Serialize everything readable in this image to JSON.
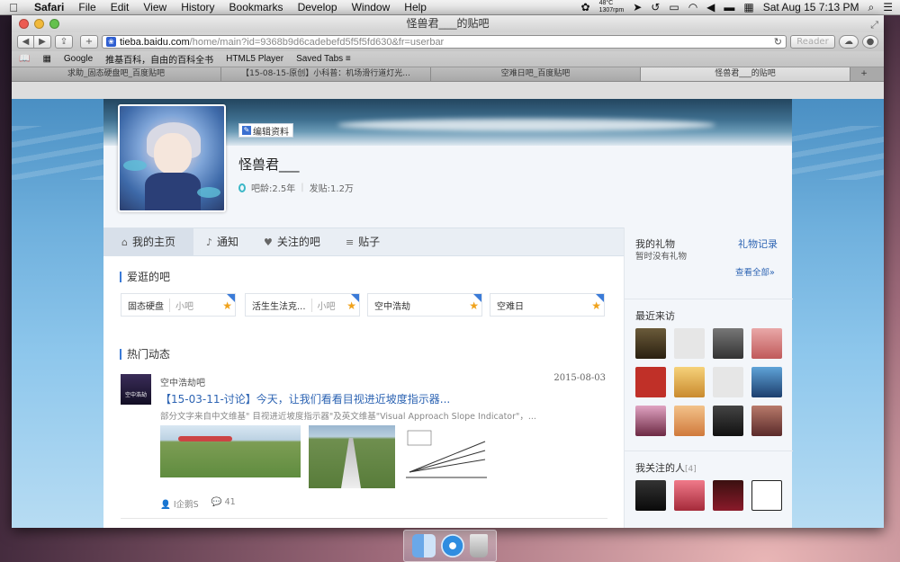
{
  "menubar": {
    "apple": "",
    "app": "Safari",
    "items": [
      "File",
      "Edit",
      "View",
      "History",
      "Bookmarks",
      "Develop",
      "Window",
      "Help"
    ],
    "temp": "48°C",
    "rpm": "1307rpm",
    "datetime": "Sat Aug 15  7:13 PM"
  },
  "window": {
    "title": "怪兽君___的贴吧"
  },
  "toolbar": {
    "back": "◀",
    "forward": "▶",
    "share": "⇪",
    "add": "+",
    "url_host": "tieba.baidu.com",
    "url_path": "/home/main?id=9368b9d6cadebefd5f5f5fd630&fr=userbar",
    "reader": "Reader",
    "reload": "↻"
  },
  "bookmarks": [
    "Google",
    "推基百科，自由的百科全书",
    "HTML5 Player",
    "Saved Tabs ≡"
  ],
  "tabs": [
    "求助_固态硬盘吧_百度贴吧",
    "【15-08-15-原创】小科普：机场滑行道灯光...",
    "空难日吧_百度贴吧",
    "怪兽君___的贴吧"
  ],
  "profile": {
    "edit_label": "编辑资料",
    "username": "怪兽君___",
    "age": "吧龄:2.5年",
    "posts": "发贴:1.2万"
  },
  "nav": [
    {
      "label": "我的主页",
      "icon": "⌂"
    },
    {
      "label": "通知",
      "icon": "♪"
    },
    {
      "label": "关注的吧",
      "icon": "♥"
    },
    {
      "label": "贴子",
      "icon": "≡"
    }
  ],
  "favorites": {
    "title": "爱逛的吧",
    "items": [
      {
        "name": "固态硬盘",
        "level": "小吧"
      },
      {
        "name": "活生生法克...",
        "level": "小吧"
      },
      {
        "name": "空中浩劫",
        "level": ""
      },
      {
        "name": "空难日",
        "level": ""
      }
    ]
  },
  "hot": {
    "title": "热门动态",
    "thumb_text": "空中浩劫",
    "forum": "空中浩劫吧",
    "date": "2015-08-03",
    "post_title": "【15-03-11-讨论】今天，让我们看看目视进近坡度指示器...",
    "excerpt": "部分文字来自中文维基\" 目视进近坡度指示器\"及英文维基\"Visual Approach Slope Indicator\"，...",
    "author": "I企鹅S",
    "replies": "41"
  },
  "sidebar": {
    "gifts_title": "我的礼物",
    "gifts_empty": "暂时没有礼物",
    "gifts_record": "礼物记录",
    "see_all": "查看全部»",
    "recent_title": "最近来访",
    "following_title": "我关注的人",
    "following_count": "[4]"
  },
  "colors": {
    "accent": "#2d64b3",
    "panel": "#f3f6fa"
  }
}
